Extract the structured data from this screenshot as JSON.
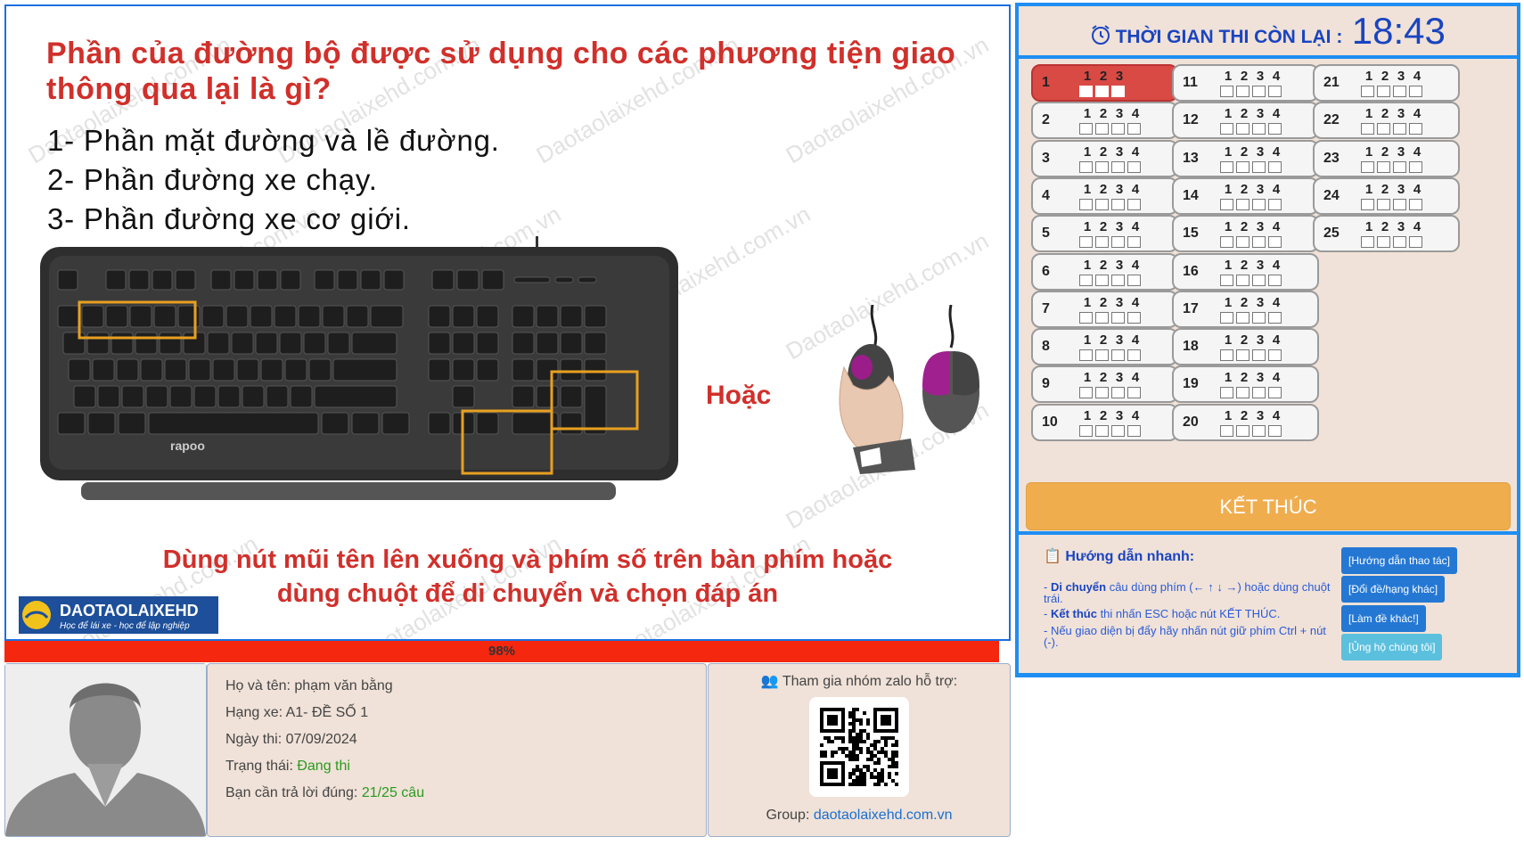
{
  "question": {
    "title": "Phần của đường bộ được sử dụng cho các phương tiện giao thông qua lại là gì?",
    "answers": [
      "1- Phần mặt đường và lề đường.",
      "2- Phần đường xe chạy.",
      "3- Phần đường xe cơ giới."
    ],
    "or_label": "Hoặc",
    "instruction": "Dùng nút mũi tên lên xuống và phím số trên bàn phím hoặc dùng chuột để di chuyển và chọn đáp án",
    "watermark": "Daotaolaixehd.com.vn",
    "logo_title": "DAOTAOLAIXEHD",
    "logo_slogan": "Học để lái xe - học để lập nghiệp",
    "keyboard_brand": "rapoo"
  },
  "progress": {
    "label": "98%",
    "value": 0.98
  },
  "student": {
    "name_label": "Họ và tên: ",
    "name": "phạm văn bằng",
    "class_label": "Hạng xe: ",
    "class": "A1- ĐỀ SỐ 1",
    "date_label": "Ngày thi: ",
    "date": "07/09/2024",
    "status_label": "Trạng thái: ",
    "status": "Đang thi",
    "required_label": "Bạn cần trả lời đúng: ",
    "required": "21/25 câu"
  },
  "zalo": {
    "title": "Tham gia nhóm zalo hỗ trợ:",
    "group_label": "Group: ",
    "group_link": "daotaolaixehd.com.vn"
  },
  "timer": {
    "label": "THỜI GIAN THI CÒN LẠI :",
    "value": "18:43"
  },
  "questions": [
    {
      "num": "1",
      "options": [
        "1",
        "2",
        "3"
      ],
      "active": true
    },
    {
      "num": "2",
      "options": [
        "1",
        "2",
        "3",
        "4"
      ]
    },
    {
      "num": "3",
      "options": [
        "1",
        "2",
        "3",
        "4"
      ]
    },
    {
      "num": "4",
      "options": [
        "1",
        "2",
        "3",
        "4"
      ]
    },
    {
      "num": "5",
      "options": [
        "1",
        "2",
        "3",
        "4"
      ]
    },
    {
      "num": "6",
      "options": [
        "1",
        "2",
        "3",
        "4"
      ]
    },
    {
      "num": "7",
      "options": [
        "1",
        "2",
        "3",
        "4"
      ]
    },
    {
      "num": "8",
      "options": [
        "1",
        "2",
        "3",
        "4"
      ]
    },
    {
      "num": "9",
      "options": [
        "1",
        "2",
        "3",
        "4"
      ]
    },
    {
      "num": "10",
      "options": [
        "1",
        "2",
        "3",
        "4"
      ]
    },
    {
      "num": "11",
      "options": [
        "1",
        "2",
        "3",
        "4"
      ]
    },
    {
      "num": "12",
      "options": [
        "1",
        "2",
        "3",
        "4"
      ]
    },
    {
      "num": "13",
      "options": [
        "1",
        "2",
        "3",
        "4"
      ]
    },
    {
      "num": "14",
      "options": [
        "1",
        "2",
        "3",
        "4"
      ]
    },
    {
      "num": "15",
      "options": [
        "1",
        "2",
        "3",
        "4"
      ]
    },
    {
      "num": "16",
      "options": [
        "1",
        "2",
        "3",
        "4"
      ]
    },
    {
      "num": "17",
      "options": [
        "1",
        "2",
        "3",
        "4"
      ]
    },
    {
      "num": "18",
      "options": [
        "1",
        "2",
        "3",
        "4"
      ]
    },
    {
      "num": "19",
      "options": [
        "1",
        "2",
        "3",
        "4"
      ]
    },
    {
      "num": "20",
      "options": [
        "1",
        "2",
        "3",
        "4"
      ]
    },
    {
      "num": "21",
      "options": [
        "1",
        "2",
        "3",
        "4"
      ]
    },
    {
      "num": "22",
      "options": [
        "1",
        "2",
        "3",
        "4"
      ]
    },
    {
      "num": "23",
      "options": [
        "1",
        "2",
        "3",
        "4"
      ]
    },
    {
      "num": "24",
      "options": [
        "1",
        "2",
        "3",
        "4"
      ]
    },
    {
      "num": "25",
      "options": [
        "1",
        "2",
        "3",
        "4"
      ]
    }
  ],
  "finish_label": "KẾT THÚC",
  "guide": {
    "title": "Hướng dẫn nhanh:",
    "line1_bold": "Di chuyển",
    "line1": " câu dùng phím (← ↑ ↓ →) hoặc dùng chuột trái.",
    "line2_bold": "Kết thúc",
    "line2": " thi nhấn ESC hoặc nút KẾT THÚC.",
    "line3": "- Nếu giao diện bị đẩy hãy nhấn nút giữ phím Ctrl + nút (-).",
    "buttons": [
      "[Hướng dẫn thao tác]",
      "[Đổi đề/hạng khác]",
      "[Làm đề khác!]",
      "[Ủng hộ chúng tôi]"
    ]
  },
  "colors": {
    "accent": "#1e8ef2",
    "danger": "#d0302b",
    "panel_bg": "#f0e2d8",
    "progress": "#f5270f",
    "finish": "#f0ad4e"
  }
}
